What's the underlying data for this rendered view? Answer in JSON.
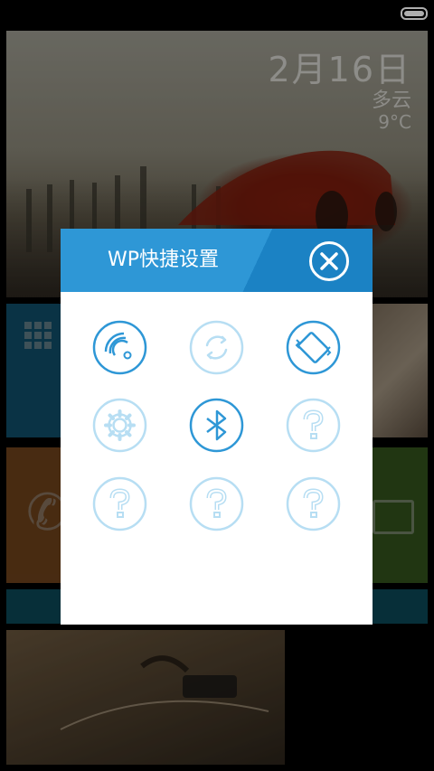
{
  "status_bar": {
    "battery_icon": "battery-icon"
  },
  "home_tiles": {
    "date_text": "2月16日",
    "weather_text": "多云",
    "temperature_text": "9°C"
  },
  "dialog": {
    "title": "WP快捷设置",
    "close_icon": "close-icon",
    "colors": {
      "accent": "#2e97d6",
      "accent_dark": "#1b82c4",
      "inactive": "#b7def3"
    },
    "toggles": [
      {
        "name": "wifi-toggle",
        "icon": "wifi-icon",
        "state": "on"
      },
      {
        "name": "auto-sync-toggle",
        "icon": "sync-icon",
        "state": "off"
      },
      {
        "name": "vibrate-toggle",
        "icon": "vibrate-icon",
        "state": "on"
      },
      {
        "name": "settings-toggle",
        "icon": "gear-icon",
        "state": "off"
      },
      {
        "name": "bluetooth-toggle",
        "icon": "bluetooth-icon",
        "state": "on"
      },
      {
        "name": "unknown-toggle-1",
        "icon": "question-icon",
        "state": "off"
      },
      {
        "name": "unknown-toggle-2",
        "icon": "question-icon",
        "state": "off"
      },
      {
        "name": "unknown-toggle-3",
        "icon": "question-icon",
        "state": "off"
      },
      {
        "name": "unknown-toggle-4",
        "icon": "question-icon",
        "state": "off"
      }
    ]
  }
}
